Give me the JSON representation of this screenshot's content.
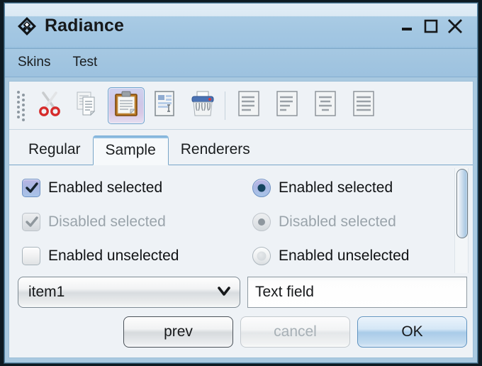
{
  "window": {
    "title": "Radiance",
    "app_icon": "diamond-logo-icon",
    "controls": [
      {
        "name": "minimize-button",
        "icon": "minimize-icon"
      },
      {
        "name": "maximize-button",
        "icon": "maximize-icon"
      },
      {
        "name": "close-button",
        "icon": "close-icon"
      }
    ]
  },
  "menubar": {
    "items": [
      {
        "label": "Skins"
      },
      {
        "label": "Test"
      }
    ]
  },
  "toolbar": {
    "drag_handle_icon": "drag-handle-icon",
    "buttons": [
      {
        "name": "cut-button",
        "icon": "scissors-icon",
        "selected": false
      },
      {
        "name": "copy-button",
        "icon": "copy-documents-icon",
        "selected": false
      },
      {
        "name": "paste-button",
        "icon": "clipboard-icon",
        "selected": true
      },
      {
        "name": "edit-form-button",
        "icon": "text-form-icon",
        "selected": false
      },
      {
        "name": "shred-button",
        "icon": "shredder-icon",
        "selected": false
      },
      {
        "name": "align-left-button",
        "icon": "align-left-icon",
        "selected": false
      },
      {
        "name": "align-center-button",
        "icon": "align-center-icon",
        "selected": false
      },
      {
        "name": "align-right-button",
        "icon": "align-right-icon",
        "selected": false
      },
      {
        "name": "align-justify-button",
        "icon": "align-justify-icon",
        "selected": false
      }
    ]
  },
  "tabs": {
    "items": [
      {
        "label": "Regular",
        "active": false
      },
      {
        "label": "Sample",
        "active": true
      },
      {
        "label": "Renderers",
        "active": false
      }
    ]
  },
  "content": {
    "checkboxes": [
      {
        "label": "Enabled selected",
        "checked": true,
        "enabled": true
      },
      {
        "label": "Disabled selected",
        "checked": true,
        "enabled": false
      },
      {
        "label": "Enabled unselected",
        "checked": false,
        "enabled": true
      }
    ],
    "radios": [
      {
        "label": "Enabled selected",
        "selected": true,
        "enabled": true
      },
      {
        "label": "Disabled selected",
        "selected": true,
        "enabled": false
      },
      {
        "label": "Enabled unselected",
        "selected": false,
        "enabled": true
      }
    ],
    "scrollbar": {
      "name": "vertical-scrollbar",
      "thumb_position": "top"
    },
    "combobox": {
      "value": "item1",
      "options": [
        "item1"
      ],
      "arrow_icon": "chevron-down-icon"
    },
    "textfield": {
      "value": "Text field",
      "placeholder": "Text field"
    }
  },
  "buttons": {
    "prev": {
      "label": "prev",
      "state": "normal"
    },
    "cancel": {
      "label": "cancel",
      "state": "disabled"
    },
    "ok": {
      "label": "OK",
      "state": "default"
    }
  },
  "colors": {
    "titlebar_blue": "#a2c6e2",
    "frame_blue": "#a9c9e0",
    "panel": "#eef2f6",
    "accent_border": "#78a6c8",
    "selected_toolbar": "#cfc7e8",
    "default_button": "#a9cbe8",
    "disabled_text": "#a7b0b6"
  }
}
